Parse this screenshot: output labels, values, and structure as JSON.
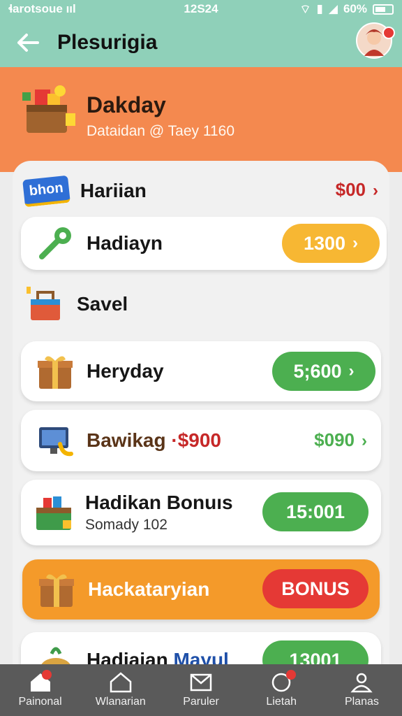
{
  "status_bar": {
    "carrier": "ɬarotsoue ııl",
    "time": "12S24",
    "battery": "60%"
  },
  "header": {
    "title": "Plesurigia"
  },
  "banner": {
    "title": "Dakday",
    "subtitle": "Dataidan @ Taey 1160"
  },
  "rows": [
    {
      "label": "Hariian",
      "value": "$00",
      "badge_text": "bhon"
    },
    {
      "label": "Hadiayn",
      "value": "1300"
    },
    {
      "label": "Savel"
    },
    {
      "label": "Heryday",
      "value": "5;600"
    },
    {
      "label": "Bawikag",
      "label_accent": "·$900",
      "value": "$090"
    },
    {
      "label": "Hadikan Bonuıs",
      "sub": "Somady 102",
      "value": "15:001"
    },
    {
      "label": "Hackataryian",
      "value": "BONUS"
    },
    {
      "label": "Hadiaian",
      "label_accent": "Mayul",
      "value": "13001"
    }
  ],
  "nav": [
    {
      "label": "Painonal",
      "icon": "home-icon"
    },
    {
      "label": "Wlanarian",
      "icon": "house-outline-icon"
    },
    {
      "label": "Paruler",
      "icon": "mail-icon"
    },
    {
      "label": "Lietah",
      "icon": "chat-icon"
    },
    {
      "label": "Planas",
      "icon": "people-icon"
    }
  ],
  "colors": {
    "teal": "#8fd0b9",
    "orange": "#f4894f",
    "green": "#4caf50",
    "red": "#c62828",
    "yellow": "#f7b733"
  }
}
